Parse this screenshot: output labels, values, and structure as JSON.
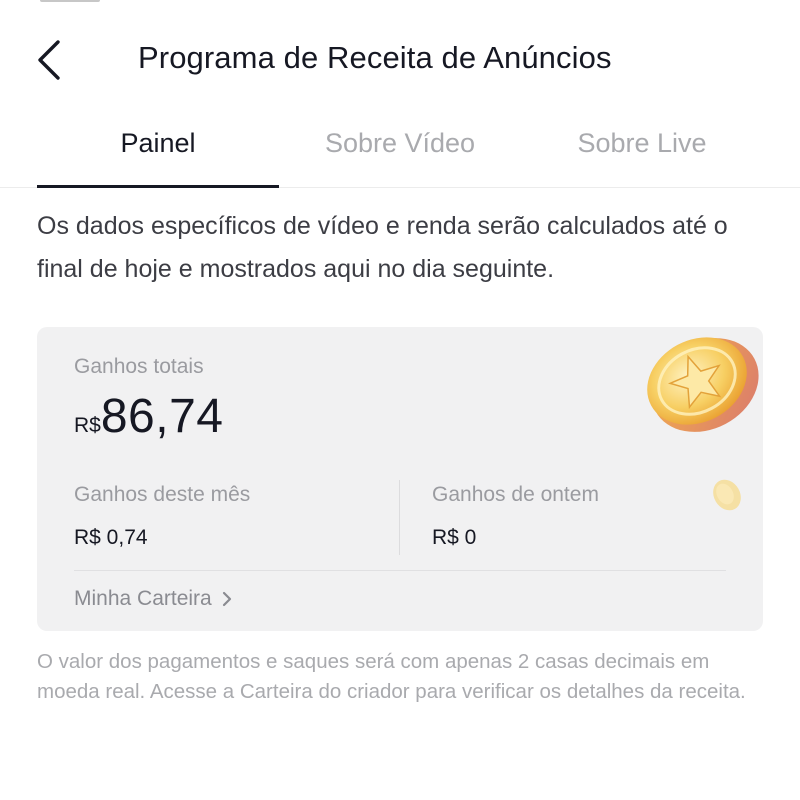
{
  "header": {
    "title": "Programa de Receita de Anúncios",
    "back_icon": "back-chevron-icon"
  },
  "tabs": [
    {
      "label": "Painel",
      "active": true
    },
    {
      "label": "Sobre Vídeo",
      "active": false
    },
    {
      "label": "Sobre Live",
      "active": false
    }
  ],
  "info": {
    "text": "Os dados específicos de vídeo e renda serão calculados até o final de hoje e mostrados aqui no dia seguinte."
  },
  "earnings": {
    "total_label": "Ganhos totais",
    "currency": "R$",
    "total_value": "86,74",
    "month_label": "Ganhos deste mês",
    "month_value": "R$ 0,74",
    "yesterday_label": "Ganhos de ontem",
    "yesterday_value": "R$ 0",
    "wallet_link": "Minha Carteira"
  },
  "footer": {
    "note": "O valor dos pagamentos e saques será com apenas 2 casas decimais em moeda real. Acesse a Carteira do criador para verificar os detalhes da receita."
  },
  "colors": {
    "text_primary": "#161823",
    "text_secondary": "#9a9ba0",
    "card_background": "#f1f1f2",
    "coin_gold": "#f6c454"
  }
}
